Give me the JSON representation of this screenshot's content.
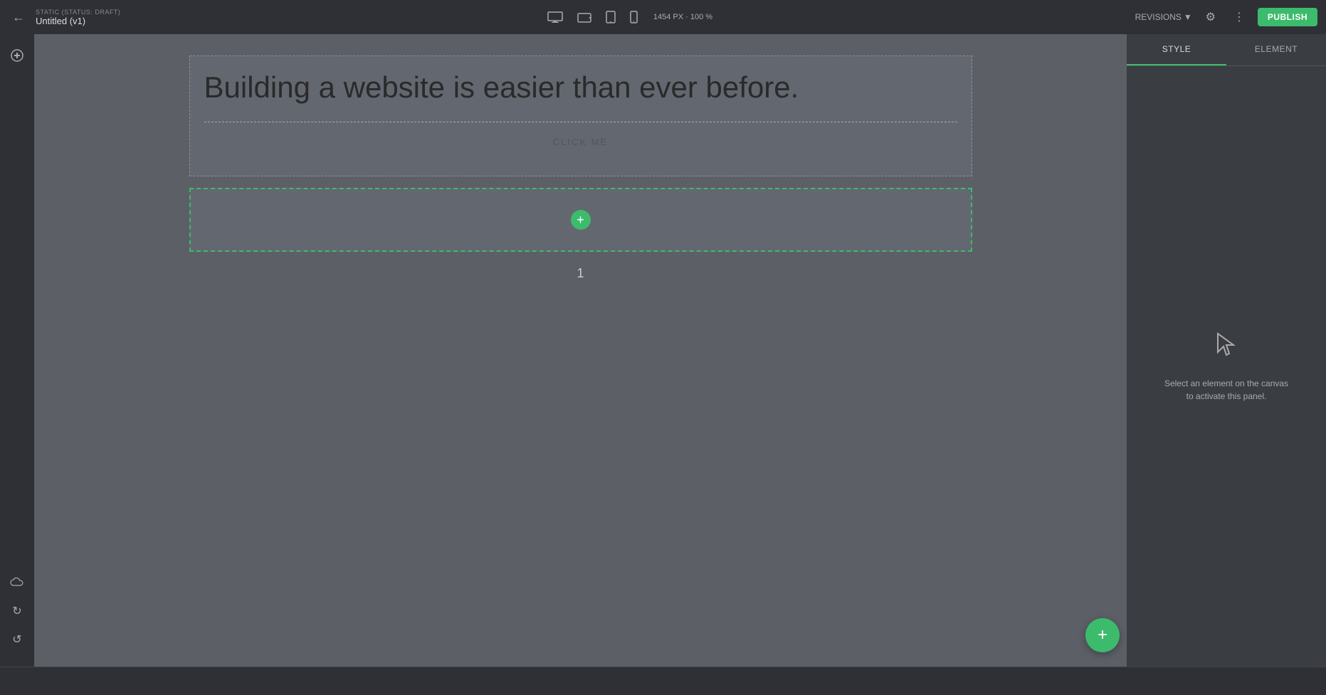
{
  "header": {
    "status": "STATIC (STATUS: DRAFT)",
    "title": "Untitled (v1)",
    "viewport": "1454 PX · 100 %",
    "revisions_label": "REVISIONS",
    "publish_label": "PUBLISH"
  },
  "devices": [
    {
      "name": "desktop",
      "icon": "🖥"
    },
    {
      "name": "tablet-landscape",
      "icon": "⬜"
    },
    {
      "name": "tablet-portrait",
      "icon": "▭"
    },
    {
      "name": "mobile",
      "icon": "📱"
    }
  ],
  "canvas": {
    "heading": "Building a website is easier than ever before.",
    "click_me_label": "CLICK ME",
    "add_section_label": "+",
    "page_number": "1"
  },
  "right_panel": {
    "tabs": [
      {
        "id": "style",
        "label": "STYLE"
      },
      {
        "id": "element",
        "label": "ELEMENT"
      }
    ],
    "active_tab": "style",
    "hint_line1": "Select an element on the canvas",
    "hint_line2": "to activate this panel."
  },
  "sidebar": {
    "top_icon": "+",
    "bottom_icons": [
      "☁",
      "↺",
      "↺"
    ]
  },
  "floating_btn": {
    "label": "+"
  }
}
